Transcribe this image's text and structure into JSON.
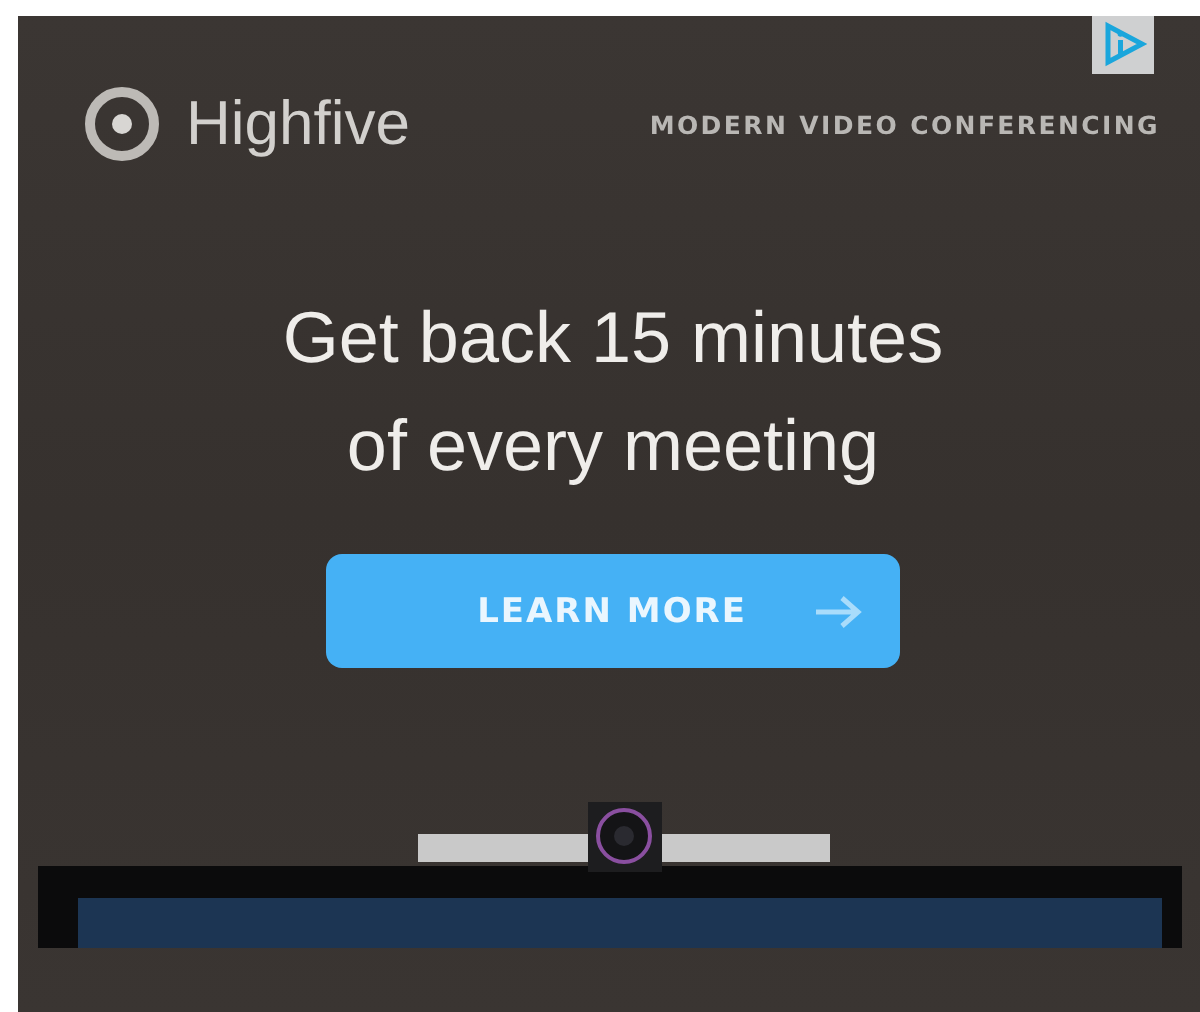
{
  "brand": {
    "name": "Highfive"
  },
  "tagline": "MODERN VIDEO CONFERENCING",
  "headline": [
    "Get back 15 minutes",
    "of every meeting"
  ],
  "cta": {
    "label": "LEARN MORE"
  }
}
